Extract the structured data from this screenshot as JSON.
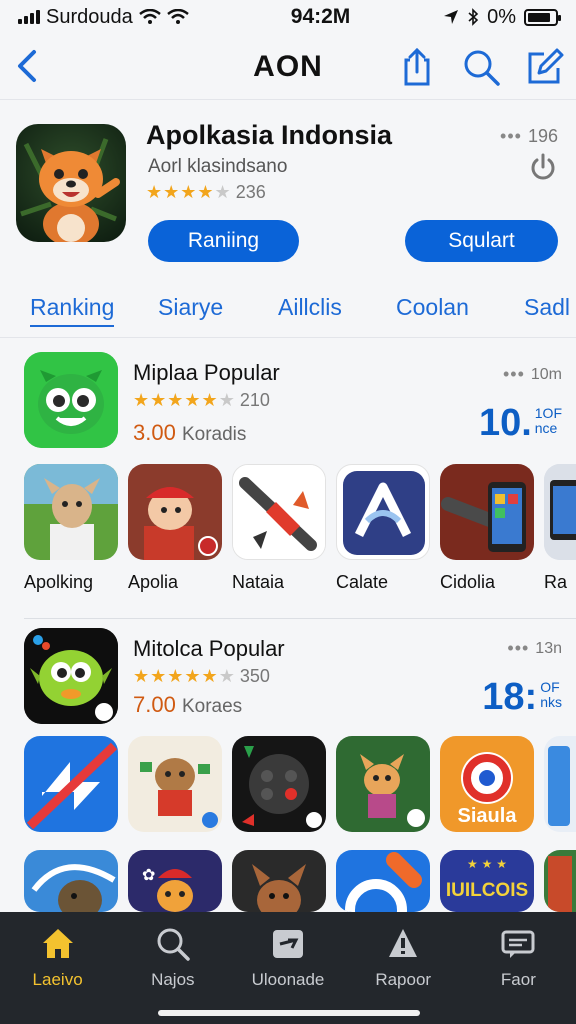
{
  "status": {
    "carrier": "Surdouda",
    "time": "94:2M",
    "battery": "0%"
  },
  "nav": {
    "title": "AON"
  },
  "featured": {
    "name": "Apolkasia Indonsia",
    "subtitle": "Aorl klasindsano",
    "rating_count": "236",
    "rating": 4,
    "meta": "196",
    "btn_primary": "Raniing",
    "btn_secondary": "Squlart"
  },
  "tabs": [
    "Ranking",
    "Siarye",
    "Aillclis",
    "Coolan",
    "Sadl"
  ],
  "sections": [
    {
      "title": "Miplaa Popular",
      "rating_count": "210",
      "rating": 4.5,
      "price": "3.00",
      "price_unit": "Koradis",
      "duration": "10m",
      "big_value": "10.",
      "big_top": "1OF",
      "big_bottom": "nce",
      "items": [
        "Apolking",
        "Apolia",
        "Nataia",
        "Calate",
        "Cidolia",
        "Ra"
      ]
    },
    {
      "title": "Mitolca Popular",
      "rating_count": "350",
      "rating": 4.5,
      "price": "7.00",
      "price_unit": "Koraes",
      "duration": "13n",
      "big_value": "18:",
      "big_top": "OF",
      "big_bottom": "nks",
      "tile_text": "Siaula",
      "tile_text2": "IUILCOIS"
    }
  ],
  "tabbar": [
    "Laeivo",
    "Najos",
    "Uloonade",
    "Rapoor",
    "Faor"
  ],
  "colors": {
    "accent": "#0a63d8",
    "tab_active": "#f3c22f",
    "tabbar_bg": "#23272c"
  }
}
